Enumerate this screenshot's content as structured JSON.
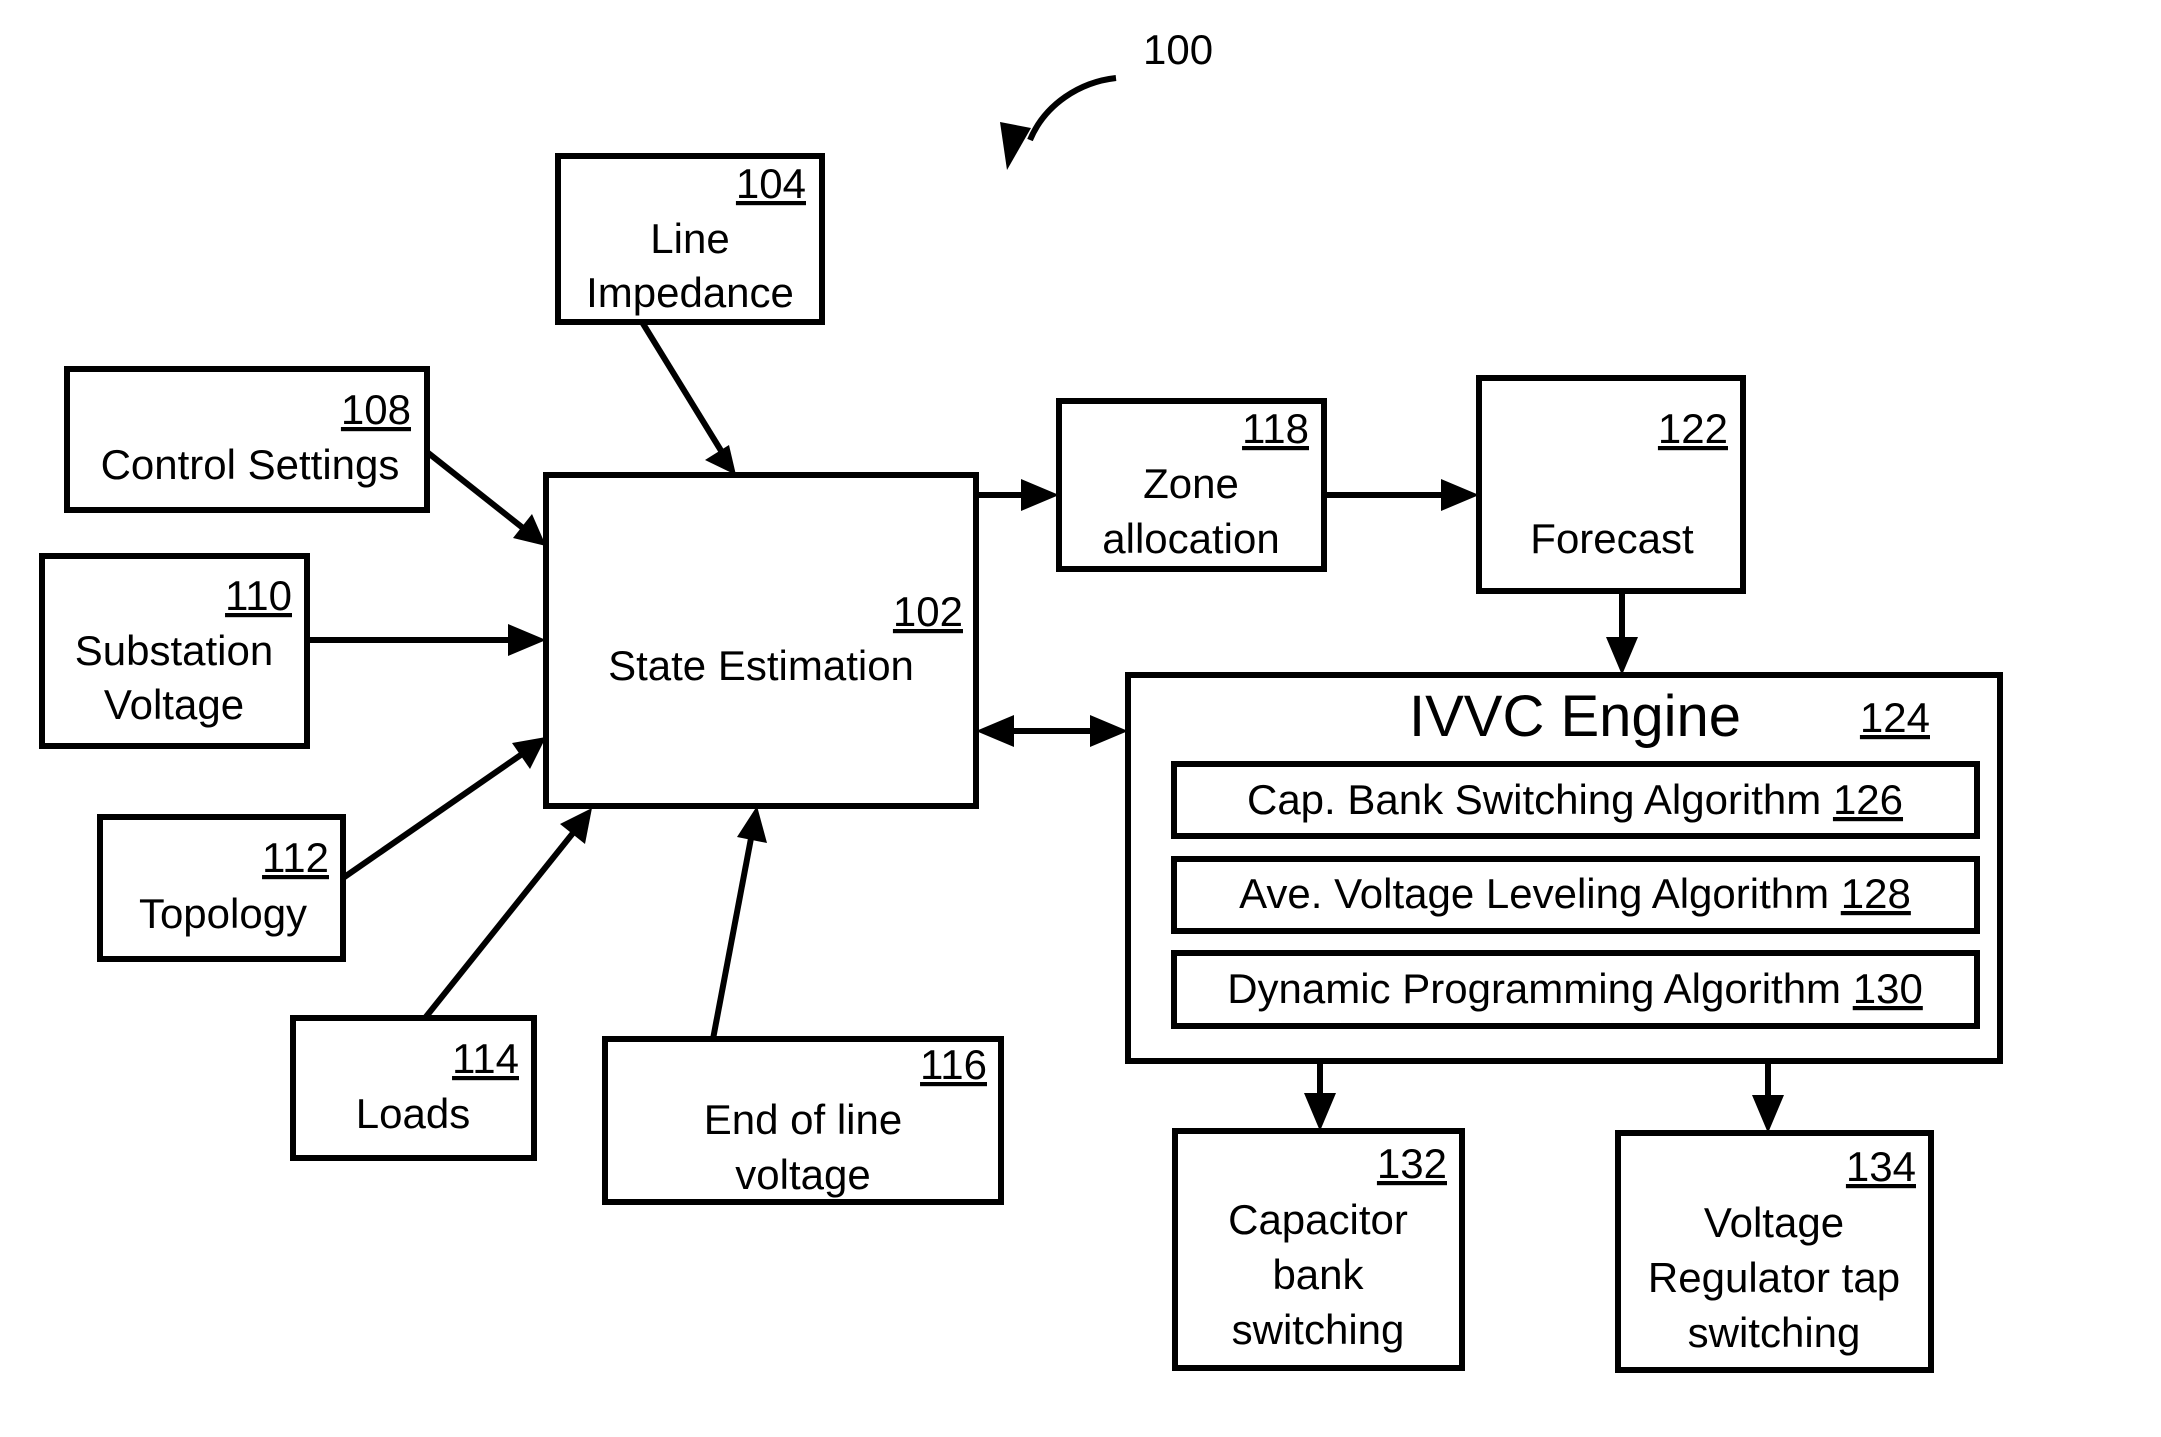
{
  "figure": {
    "ref": "100"
  },
  "nodes": {
    "state_estimation": {
      "ref": "102",
      "lines": [
        "State Estimation"
      ]
    },
    "line_impedance": {
      "ref": "104",
      "lines": [
        "Line",
        "Impedance"
      ]
    },
    "control_settings": {
      "ref": "108",
      "lines": [
        "Control Settings"
      ]
    },
    "substation_voltage": {
      "ref": "110",
      "lines": [
        "Substation",
        "Voltage"
      ]
    },
    "topology": {
      "ref": "112",
      "lines": [
        "Topology"
      ]
    },
    "loads": {
      "ref": "114",
      "lines": [
        "Loads"
      ]
    },
    "end_of_line_voltage": {
      "ref": "116",
      "lines": [
        "End of line",
        "voltage"
      ]
    },
    "zone_allocation": {
      "ref": "118",
      "lines": [
        "Zone",
        "allocation"
      ]
    },
    "forecast": {
      "ref": "122",
      "lines": [
        "Forecast"
      ]
    },
    "ivvc_engine": {
      "ref": "124",
      "title": "IVVC Engine",
      "algorithms": [
        {
          "label": "Cap.  Bank Switching Algorithm",
          "ref": "126"
        },
        {
          "label": "Ave. Voltage Leveling Algorithm",
          "ref": "128"
        },
        {
          "label": "Dynamic Programming Algorithm",
          "ref": "130"
        }
      ]
    },
    "capacitor_bank_switching": {
      "ref": "132",
      "lines": [
        "Capacitor",
        "bank",
        "switching"
      ]
    },
    "voltage_regulator_tap_switching": {
      "ref": "134",
      "lines": [
        "Voltage",
        "Regulator tap",
        "switching"
      ]
    }
  },
  "edges": [
    {
      "from": "line_impedance",
      "to": "state_estimation",
      "direction": "forward"
    },
    {
      "from": "control_settings",
      "to": "state_estimation",
      "direction": "forward"
    },
    {
      "from": "substation_voltage",
      "to": "state_estimation",
      "direction": "forward"
    },
    {
      "from": "topology",
      "to": "state_estimation",
      "direction": "forward"
    },
    {
      "from": "loads",
      "to": "state_estimation",
      "direction": "forward"
    },
    {
      "from": "end_of_line_voltage",
      "to": "state_estimation",
      "direction": "forward"
    },
    {
      "from": "state_estimation",
      "to": "zone_allocation",
      "direction": "forward"
    },
    {
      "from": "zone_allocation",
      "to": "forecast",
      "direction": "forward"
    },
    {
      "from": "forecast",
      "to": "ivvc_engine",
      "direction": "forward"
    },
    {
      "from": "state_estimation",
      "to": "ivvc_engine",
      "direction": "bidirectional"
    },
    {
      "from": "ivvc_engine",
      "to": "capacitor_bank_switching",
      "direction": "forward"
    },
    {
      "from": "ivvc_engine",
      "to": "voltage_regulator_tap_switching",
      "direction": "forward"
    }
  ]
}
